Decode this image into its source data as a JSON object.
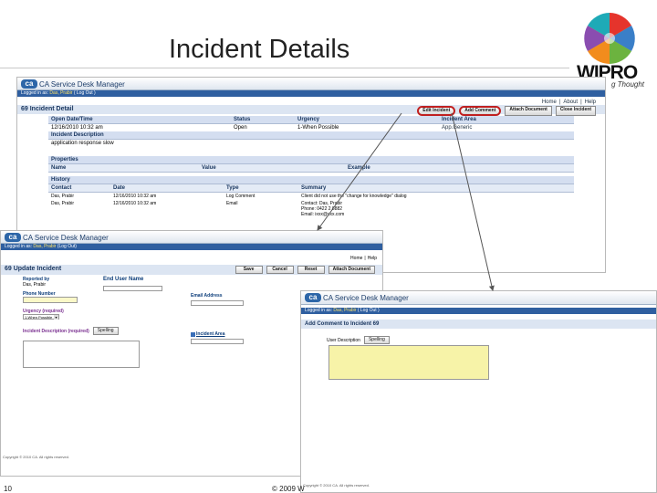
{
  "slide": {
    "title": "Incident Details",
    "page_number": "10",
    "copyright": "© 2009 W"
  },
  "logo": {
    "text": "WIPRO",
    "tagline": "g Thought"
  },
  "main_window": {
    "app_name": "CA Service Desk Manager",
    "logged_in_label": "Logged in as:",
    "user": "Das, Prabir",
    "logout": "( Log Out )",
    "top_links": [
      "Home",
      "|",
      "About",
      "|",
      "Help"
    ],
    "page_title": "69 Incident Detail",
    "buttons": [
      "Edit Incident",
      "Add Comment",
      "Attach Document",
      "Close Incident"
    ],
    "fields": {
      "headers": [
        "Open Date/Time",
        "Status",
        "Urgency",
        "Incident Area"
      ],
      "values": [
        "12/16/2010 10:32 am",
        "Open",
        "1-When Possible",
        "App.Generic"
      ]
    },
    "description_label": "Incident Description",
    "description_value": "application response slow",
    "properties_label": "Properties",
    "properties_headers": [
      "Name",
      "Value",
      "Example"
    ],
    "history_label": "History",
    "history_headers": [
      "Contact",
      "Date",
      "Type",
      "Summary"
    ],
    "history_rows": [
      [
        "Das, Prabir",
        "12/16/2010 10:32 am",
        "Log Comment",
        "Client did not use the \"change for knowledge\" dialog"
      ],
      [
        "Das, Prabir",
        "12/16/2010 10:32 am",
        "Email",
        "Contact: Das, Prabir"
      ]
    ],
    "history_extra": [
      "Phone: 0422 2 8882",
      "Email: ixxx@xxx.com"
    ]
  },
  "update_window": {
    "app_name": "CA Service Desk Manager",
    "logged_in_label": "Logged in as:",
    "user": "Das, Prabir",
    "logout": "(Log Out)",
    "top_links": [
      "Home",
      "|",
      "Help"
    ],
    "page_title": "69 Update Incident",
    "buttons": [
      "Save",
      "Cancel",
      "Reset",
      "Attach Document"
    ],
    "end_user_label": "End User Name",
    "reported_by_label": "Reported by",
    "reported_by_value": "Das, Prabir",
    "phone_label": "Phone Number",
    "email_label": "Email Address",
    "urgency_label": "Urgency (required)",
    "urgency_value": "1-When Possible",
    "incident_area_label": "Incident Area",
    "description_label": "Incident Description (required)",
    "spelling": "Spelling",
    "footer": "Copyright © 2010 CA. All rights reserved."
  },
  "comment_window": {
    "app_name": "CA Service Desk Manager",
    "logged_in_label": "Logged in as:",
    "user": "Das, Prabir",
    "logout": "( Log Out )",
    "page_title": "Add Comment to Incident 69",
    "user_description_label": "User Description",
    "spelling": "Spelling",
    "footer": "Copyright © 2010 CA. All rights reserved."
  },
  "colors": {
    "annotation": "#c02020",
    "header_blue": "#2f5fa0",
    "field_yellow": "#fbf8c8"
  }
}
